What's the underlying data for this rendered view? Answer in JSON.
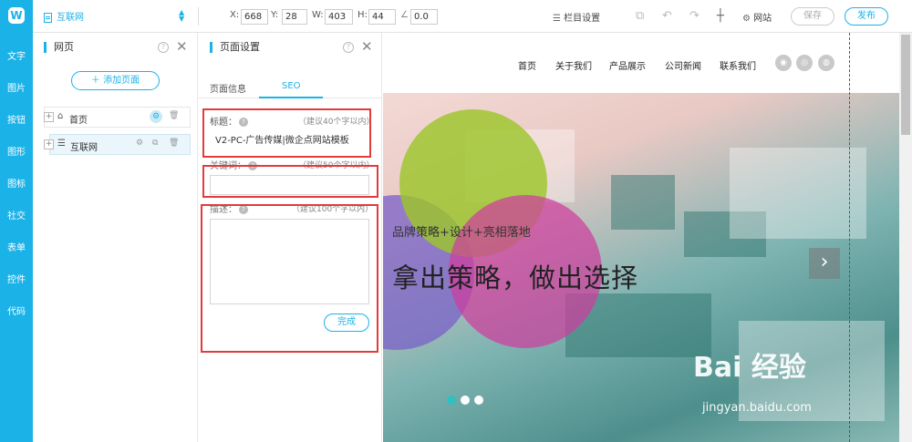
{
  "rail": {
    "logo": "W",
    "items": [
      "文字",
      "图片",
      "按钮",
      "图形",
      "图标",
      "社交",
      "表单",
      "控件",
      "代码"
    ]
  },
  "toolbar": {
    "site_name": "互联网",
    "x_label": "X:",
    "x_value": "668",
    "y_label": "Y:",
    "y_value": "28",
    "w_label": "W:",
    "w_value": "403",
    "h_label": "H:",
    "h_value": "44",
    "rotation_value": "0.0",
    "column_settings": "栏目设置",
    "site_label": "网站",
    "save_label": "保存",
    "publish_label": "发布"
  },
  "pages_panel": {
    "title": "网页",
    "add_page": "添加页面",
    "pages": [
      "首页",
      "互联网"
    ]
  },
  "settings_panel": {
    "title": "页面设置",
    "tabs": [
      "页面信息",
      "SEO"
    ],
    "title_label": "标题：",
    "title_hint": "（建议40个字以内）",
    "title_value": "V2-PC-广告传媒|微企点网站模板",
    "keywords_label": "关键词：",
    "keywords_hint": "（建议50个字以内）",
    "keywords_value": "",
    "desc_label": "描述：",
    "desc_hint": "（建议100个字以内）",
    "desc_value": "",
    "done_label": "完成"
  },
  "preview": {
    "nav": [
      "首页",
      "关于我们",
      "产品展示",
      "公司新闻",
      "联系我们"
    ],
    "slogan_small": "品牌策略+设计+亮相落地",
    "slogan_large": "拿出策略，做出选择",
    "colors": {
      "green": "#9cc62b",
      "purple": "#7a62c8",
      "magenta": "#cf3d9e",
      "accent": "#1bb2e8",
      "highlight": "#e23b3b"
    }
  },
  "watermark": {
    "brand": "Bai 经验",
    "url": "jingyan.baidu.com"
  }
}
